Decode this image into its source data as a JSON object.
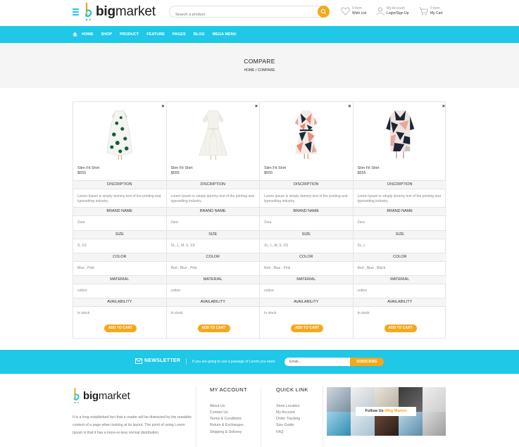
{
  "header": {
    "logo_text_bold": "big",
    "logo_text": "market",
    "search_placeholder": "Search a product",
    "wishlist": {
      "top": "0 item",
      "bottom": "Wish List"
    },
    "account": {
      "top": "My Account",
      "bottom": "Login/Sign Up"
    },
    "cart": {
      "top": "0 item",
      "bottom": "My Cart"
    },
    "icons": [
      "menu-icon",
      "search-icon",
      "heart-icon",
      "user-icon",
      "cart-icon"
    ]
  },
  "nav": {
    "items": [
      "HOME",
      "SHOP",
      "PRODUCT",
      "FEATURE",
      "PAGES",
      "BLOG",
      "MEGA MENU"
    ]
  },
  "banner": {
    "title": "COMPARE",
    "breadcrumb": [
      "HOME",
      "/",
      "COMPARE"
    ]
  },
  "compare": {
    "row_labels": {
      "description": "DISCRIPTION",
      "brand": "BRAND NAME",
      "size": "SIZE",
      "color": "COLOR",
      "material": "MATERIAL",
      "availability": "AVAILABILITY"
    },
    "add_to_cart": "ADD TO CART",
    "close": "×",
    "products": [
      {
        "name": "Slim Fit Shirt",
        "price": "$555",
        "description": "Lorem Ipsum is simply dummy text of the printing and typesetting industry.",
        "brand": "Zara",
        "size": "S, XS",
        "color": "Blue , Pink",
        "material": "cotton",
        "availability": "In stock"
      },
      {
        "name": "Slim Fit Shirt",
        "price": "$555",
        "description": "Lorem Ipsum is simply dummy text of the printing and typesetting industry.",
        "brand": "Zara",
        "size": "XL, L, M, S, XS",
        "color": "Red , Blue , Pink",
        "material": "cotton",
        "availability": "In stock"
      },
      {
        "name": "Slim Fit Shirt",
        "price": "$555",
        "description": "Lorem Ipsum is simply dummy text of the printing and typesetting industry.",
        "brand": "Zara",
        "size": "XL, L, M, S, XS",
        "color": "Red , Blue , Pink",
        "material": "cotton",
        "availability": "In stock"
      },
      {
        "name": "Slim Fit Shirt",
        "price": "$555",
        "description": "Lorem Ipsum is simply dummy text of the printing and typesetting industry.",
        "brand": "Zara",
        "size": "XL, L",
        "color": "Red , Blue , Black",
        "material": "cotton",
        "availability": "In stock"
      }
    ]
  },
  "newsletter": {
    "title": "NEWSLETTER",
    "text": "If you are going to use a passage of Lorem you need.",
    "email_placeholder": "Email...",
    "button": "SUBSCRIBE"
  },
  "footer": {
    "description": "It is a long established fact that a reader will be distracted by the readable content of a page when looking at its layout. The point of using Lorem Ipsum is that it has a more-or-less normal distribution",
    "my_account": {
      "title": "MY ACCOUNT",
      "links": [
        "About Us",
        "Contact Us",
        "Terms & Conditions",
        "Return & Exchanges",
        "Shipping & Delivery"
      ]
    },
    "quick_link": {
      "title": "QUICK LINK",
      "links": [
        "Store Location",
        "My Account",
        "Order Tracking",
        "Size Guide",
        "FAQ"
      ]
    },
    "instagram": {
      "prefix": "Follow Us ",
      "tag": "#Big Market"
    }
  },
  "colors": {
    "accent": "#1ec8e6",
    "button": "#f5a81b"
  }
}
